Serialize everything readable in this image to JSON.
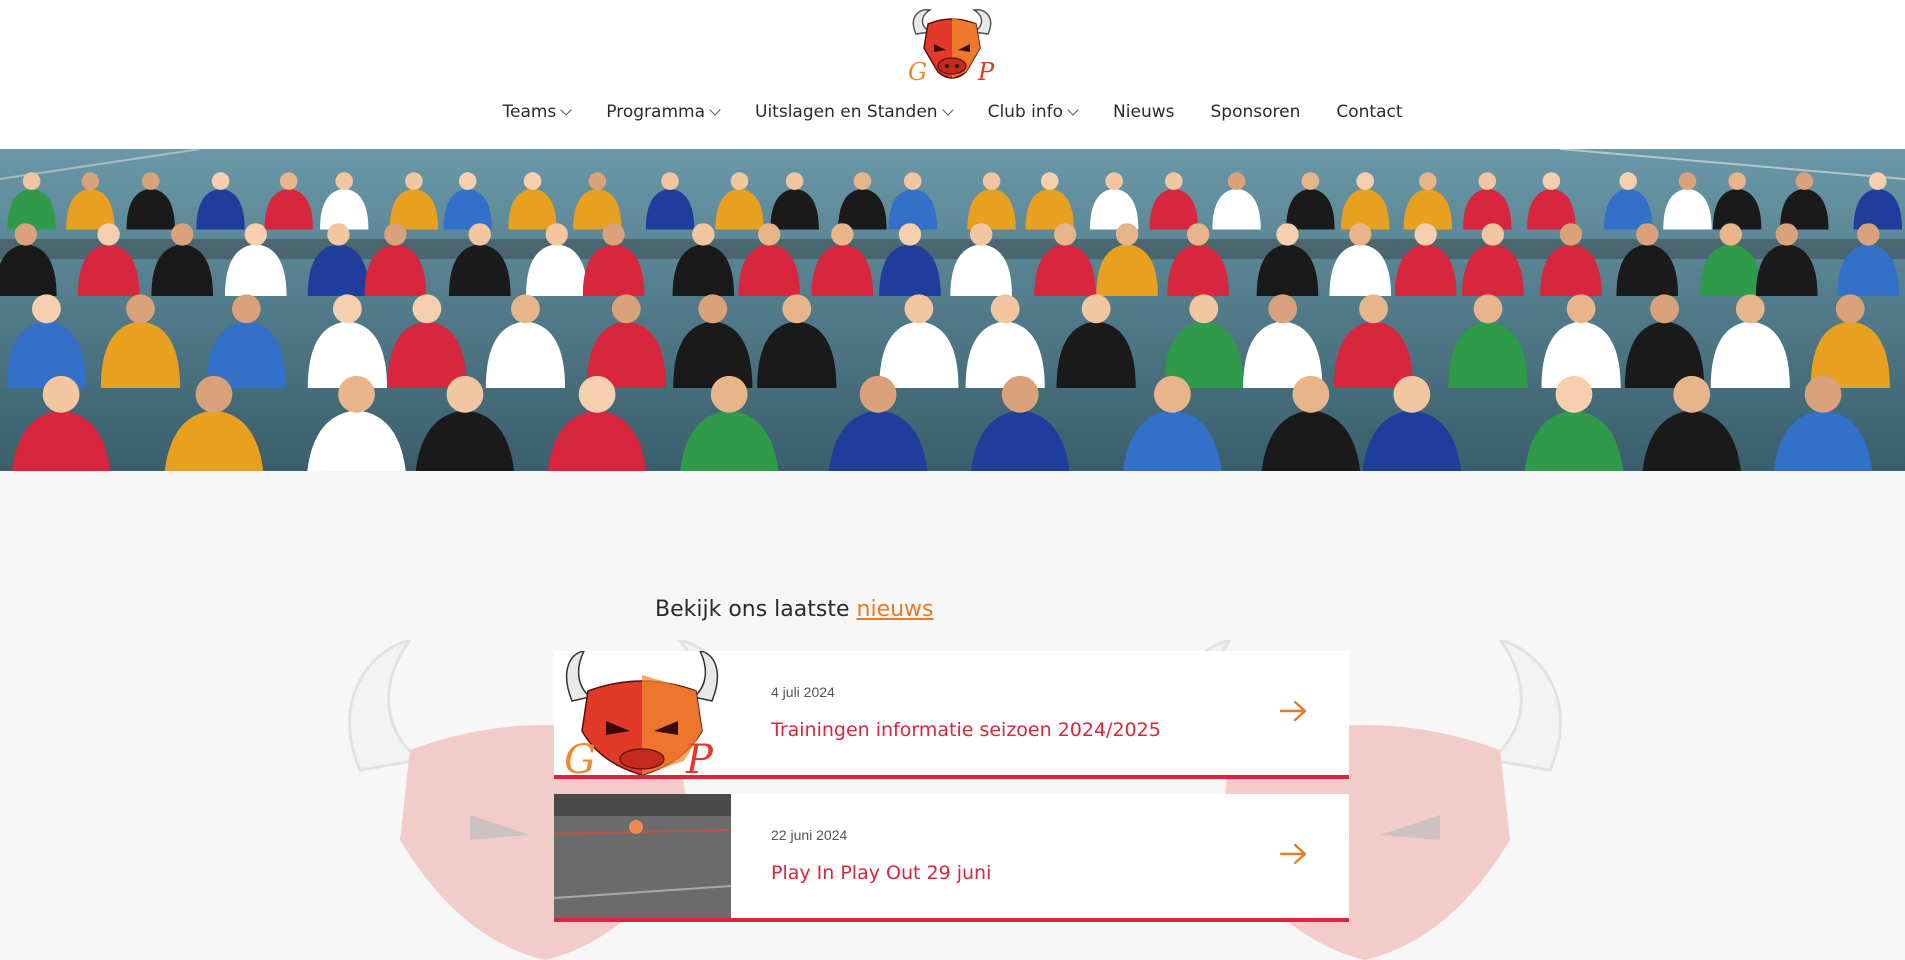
{
  "header": {
    "logo_text": "GP Bulls",
    "nav": [
      {
        "label": "Teams",
        "has_dropdown": true
      },
      {
        "label": "Programma",
        "has_dropdown": true
      },
      {
        "label": "Uitslagen en Standen",
        "has_dropdown": true
      },
      {
        "label": "Club info",
        "has_dropdown": true
      },
      {
        "label": "Nieuws",
        "has_dropdown": false
      },
      {
        "label": "Sponsoren",
        "has_dropdown": false
      },
      {
        "label": "Contact",
        "has_dropdown": false
      }
    ]
  },
  "hero": {
    "image": "team-group-photo"
  },
  "news": {
    "intro_text": "Bekijk ons laatste ",
    "intro_link": "nieuws",
    "items": [
      {
        "date": "4 juli 2024",
        "title": "Trainingen informatie seizoen 2024/2025",
        "thumbnail": "bulls-logo"
      },
      {
        "date": "22 juni 2024",
        "title": "Play In Play Out 29 juni",
        "thumbnail": "floor-ball-photo"
      }
    ]
  },
  "colors": {
    "accent_orange": "#ea7b25",
    "accent_red": "#d7263d",
    "background": "#f7f7f7",
    "header_bg": "#ffffff"
  },
  "icons": [
    "chevron-down-icon",
    "arrow-right-icon"
  ]
}
